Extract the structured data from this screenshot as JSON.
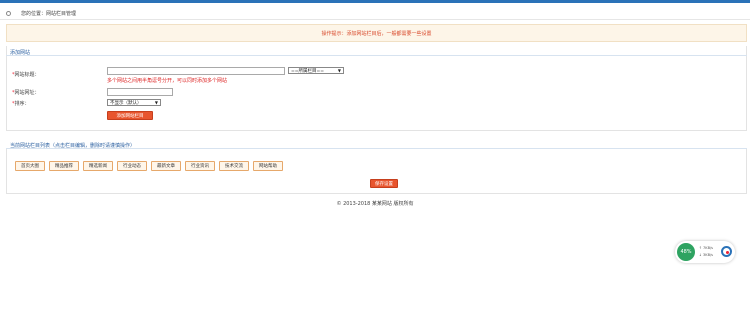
{
  "breadcrumb": {
    "prefix": "您的位置：",
    "current": "网站栏目管理"
  },
  "notice": "操作提示：添加网站栏目后，一般都需要一些设置",
  "form": {
    "title": "添加网站",
    "fields": [
      {
        "label": "网站标题：",
        "value": ""
      },
      {
        "label": "网站网址：",
        "value": ""
      },
      {
        "label": "排序：",
        "value": ""
      }
    ],
    "section_select": "==所属栏目==",
    "hint": "多个网站之间用半角逗号分开，可以同时添加多个网站",
    "status_select": "不显示（默认）",
    "submit_label": "添加网站栏目"
  },
  "section": {
    "title": "当前网站栏目列表（点击栏目编辑，删除时请谨慎操作）",
    "tags": [
      "首页大图",
      "精品推荐",
      "精选新闻",
      "行业动态",
      "最新文章",
      "行业资讯",
      "技术交流",
      "网站帮助"
    ],
    "action_label": "保存设置"
  },
  "footer": "© 2013-2018 某某网站 版权所有",
  "widget": {
    "percent": "48%",
    "line1": "7KB/s",
    "line2": "3KB/s"
  }
}
